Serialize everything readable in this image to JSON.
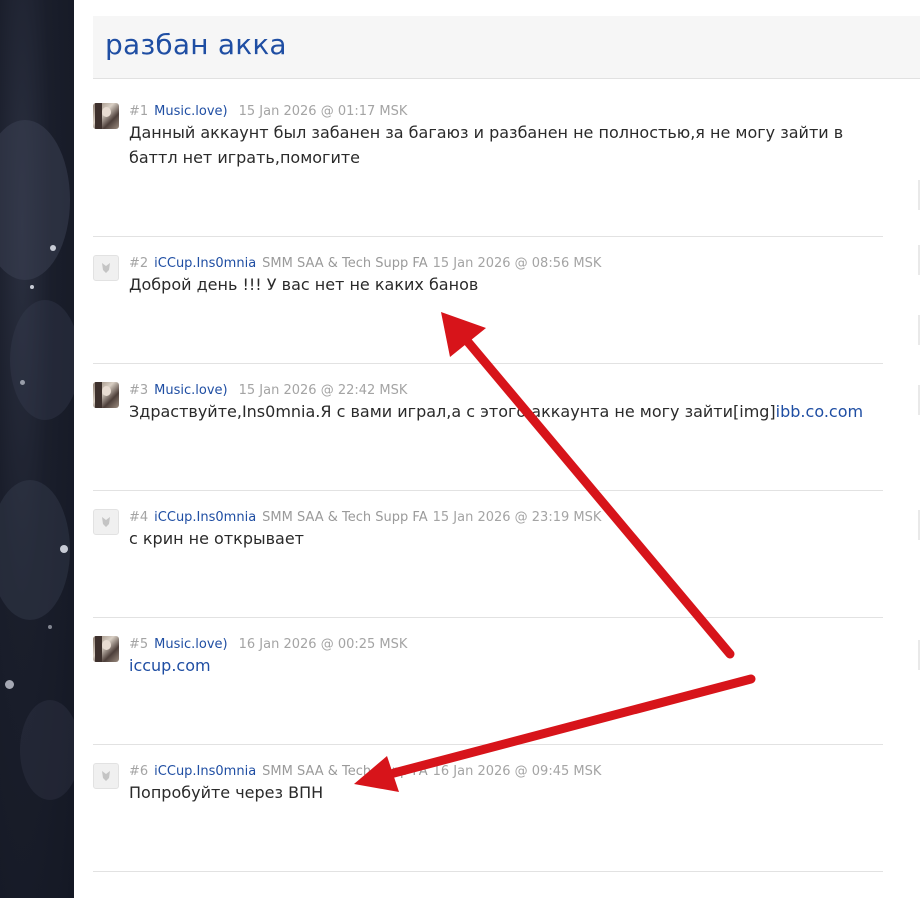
{
  "topic": {
    "title": "разбан акка"
  },
  "posts": [
    {
      "num": "#1",
      "author": "Music.love)",
      "role": "",
      "date": "15 Jan 2026 @ 01:17 MSK",
      "text": "Данный аккаунт был забанен за багаюз и разбанен не полностью,я не могу зайти в баттл нет играть,помогите",
      "link": ""
    },
    {
      "num": "#2",
      "author": "iCCup.Ins0mnia",
      "role": "SMM SAA & Tech Supp FA",
      "date": "15 Jan 2026 @ 08:56 MSK",
      "text": "Доброй день !!! У вас нет не каких банов",
      "link": ""
    },
    {
      "num": "#3",
      "author": "Music.love)",
      "role": "",
      "date": "15 Jan 2026 @ 22:42 MSK",
      "text": "Здраствуйте,Ins0mnia.Я с вами играл,а с этого аккаунта не могу зайти[img]",
      "link": "ibb.co.com"
    },
    {
      "num": "#4",
      "author": "iCCup.Ins0mnia",
      "role": "SMM SAA & Tech Supp FA",
      "date": "15 Jan 2026 @ 23:19 MSK",
      "text": "с крин не открывает",
      "link": ""
    },
    {
      "num": "#5",
      "author": "Music.love)",
      "role": "",
      "date": "16 Jan 2026 @ 00:25 MSK",
      "text": "",
      "link": "iccup.com"
    },
    {
      "num": "#6",
      "author": "iCCup.Ins0mnia",
      "role": "SMM SAA & Tech Supp FA",
      "date": "16 Jan 2026 @ 09:45 MSK",
      "text": "Попробуйте через ВПН",
      "link": ""
    }
  ],
  "annotation_color": "#d7141a"
}
